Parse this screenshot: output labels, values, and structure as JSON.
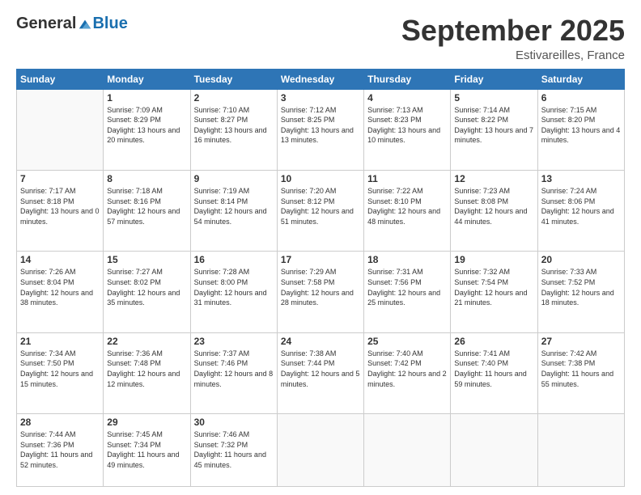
{
  "logo": {
    "general": "General",
    "blue": "Blue"
  },
  "header": {
    "title": "September 2025",
    "subtitle": "Estivareilles, France"
  },
  "days_of_week": [
    "Sunday",
    "Monday",
    "Tuesday",
    "Wednesday",
    "Thursday",
    "Friday",
    "Saturday"
  ],
  "weeks": [
    [
      {
        "day": "",
        "sunrise": "",
        "sunset": "",
        "daylight": ""
      },
      {
        "day": "1",
        "sunrise": "Sunrise: 7:09 AM",
        "sunset": "Sunset: 8:29 PM",
        "daylight": "Daylight: 13 hours and 20 minutes."
      },
      {
        "day": "2",
        "sunrise": "Sunrise: 7:10 AM",
        "sunset": "Sunset: 8:27 PM",
        "daylight": "Daylight: 13 hours and 16 minutes."
      },
      {
        "day": "3",
        "sunrise": "Sunrise: 7:12 AM",
        "sunset": "Sunset: 8:25 PM",
        "daylight": "Daylight: 13 hours and 13 minutes."
      },
      {
        "day": "4",
        "sunrise": "Sunrise: 7:13 AM",
        "sunset": "Sunset: 8:23 PM",
        "daylight": "Daylight: 13 hours and 10 minutes."
      },
      {
        "day": "5",
        "sunrise": "Sunrise: 7:14 AM",
        "sunset": "Sunset: 8:22 PM",
        "daylight": "Daylight: 13 hours and 7 minutes."
      },
      {
        "day": "6",
        "sunrise": "Sunrise: 7:15 AM",
        "sunset": "Sunset: 8:20 PM",
        "daylight": "Daylight: 13 hours and 4 minutes."
      }
    ],
    [
      {
        "day": "7",
        "sunrise": "Sunrise: 7:17 AM",
        "sunset": "Sunset: 8:18 PM",
        "daylight": "Daylight: 13 hours and 0 minutes."
      },
      {
        "day": "8",
        "sunrise": "Sunrise: 7:18 AM",
        "sunset": "Sunset: 8:16 PM",
        "daylight": "Daylight: 12 hours and 57 minutes."
      },
      {
        "day": "9",
        "sunrise": "Sunrise: 7:19 AM",
        "sunset": "Sunset: 8:14 PM",
        "daylight": "Daylight: 12 hours and 54 minutes."
      },
      {
        "day": "10",
        "sunrise": "Sunrise: 7:20 AM",
        "sunset": "Sunset: 8:12 PM",
        "daylight": "Daylight: 12 hours and 51 minutes."
      },
      {
        "day": "11",
        "sunrise": "Sunrise: 7:22 AM",
        "sunset": "Sunset: 8:10 PM",
        "daylight": "Daylight: 12 hours and 48 minutes."
      },
      {
        "day": "12",
        "sunrise": "Sunrise: 7:23 AM",
        "sunset": "Sunset: 8:08 PM",
        "daylight": "Daylight: 12 hours and 44 minutes."
      },
      {
        "day": "13",
        "sunrise": "Sunrise: 7:24 AM",
        "sunset": "Sunset: 8:06 PM",
        "daylight": "Daylight: 12 hours and 41 minutes."
      }
    ],
    [
      {
        "day": "14",
        "sunrise": "Sunrise: 7:26 AM",
        "sunset": "Sunset: 8:04 PM",
        "daylight": "Daylight: 12 hours and 38 minutes."
      },
      {
        "day": "15",
        "sunrise": "Sunrise: 7:27 AM",
        "sunset": "Sunset: 8:02 PM",
        "daylight": "Daylight: 12 hours and 35 minutes."
      },
      {
        "day": "16",
        "sunrise": "Sunrise: 7:28 AM",
        "sunset": "Sunset: 8:00 PM",
        "daylight": "Daylight: 12 hours and 31 minutes."
      },
      {
        "day": "17",
        "sunrise": "Sunrise: 7:29 AM",
        "sunset": "Sunset: 7:58 PM",
        "daylight": "Daylight: 12 hours and 28 minutes."
      },
      {
        "day": "18",
        "sunrise": "Sunrise: 7:31 AM",
        "sunset": "Sunset: 7:56 PM",
        "daylight": "Daylight: 12 hours and 25 minutes."
      },
      {
        "day": "19",
        "sunrise": "Sunrise: 7:32 AM",
        "sunset": "Sunset: 7:54 PM",
        "daylight": "Daylight: 12 hours and 21 minutes."
      },
      {
        "day": "20",
        "sunrise": "Sunrise: 7:33 AM",
        "sunset": "Sunset: 7:52 PM",
        "daylight": "Daylight: 12 hours and 18 minutes."
      }
    ],
    [
      {
        "day": "21",
        "sunrise": "Sunrise: 7:34 AM",
        "sunset": "Sunset: 7:50 PM",
        "daylight": "Daylight: 12 hours and 15 minutes."
      },
      {
        "day": "22",
        "sunrise": "Sunrise: 7:36 AM",
        "sunset": "Sunset: 7:48 PM",
        "daylight": "Daylight: 12 hours and 12 minutes."
      },
      {
        "day": "23",
        "sunrise": "Sunrise: 7:37 AM",
        "sunset": "Sunset: 7:46 PM",
        "daylight": "Daylight: 12 hours and 8 minutes."
      },
      {
        "day": "24",
        "sunrise": "Sunrise: 7:38 AM",
        "sunset": "Sunset: 7:44 PM",
        "daylight": "Daylight: 12 hours and 5 minutes."
      },
      {
        "day": "25",
        "sunrise": "Sunrise: 7:40 AM",
        "sunset": "Sunset: 7:42 PM",
        "daylight": "Daylight: 12 hours and 2 minutes."
      },
      {
        "day": "26",
        "sunrise": "Sunrise: 7:41 AM",
        "sunset": "Sunset: 7:40 PM",
        "daylight": "Daylight: 11 hours and 59 minutes."
      },
      {
        "day": "27",
        "sunrise": "Sunrise: 7:42 AM",
        "sunset": "Sunset: 7:38 PM",
        "daylight": "Daylight: 11 hours and 55 minutes."
      }
    ],
    [
      {
        "day": "28",
        "sunrise": "Sunrise: 7:44 AM",
        "sunset": "Sunset: 7:36 PM",
        "daylight": "Daylight: 11 hours and 52 minutes."
      },
      {
        "day": "29",
        "sunrise": "Sunrise: 7:45 AM",
        "sunset": "Sunset: 7:34 PM",
        "daylight": "Daylight: 11 hours and 49 minutes."
      },
      {
        "day": "30",
        "sunrise": "Sunrise: 7:46 AM",
        "sunset": "Sunset: 7:32 PM",
        "daylight": "Daylight: 11 hours and 45 minutes."
      },
      {
        "day": "",
        "sunrise": "",
        "sunset": "",
        "daylight": ""
      },
      {
        "day": "",
        "sunrise": "",
        "sunset": "",
        "daylight": ""
      },
      {
        "day": "",
        "sunrise": "",
        "sunset": "",
        "daylight": ""
      },
      {
        "day": "",
        "sunrise": "",
        "sunset": "",
        "daylight": ""
      }
    ]
  ]
}
